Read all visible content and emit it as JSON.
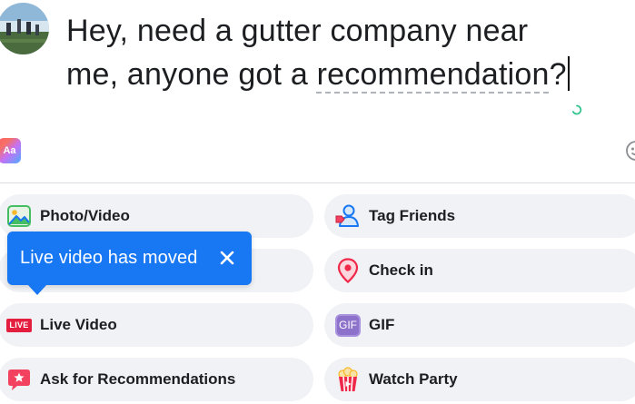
{
  "composer": {
    "text_line1": "Hey, need a gutter company near",
    "text_line2_prefix": "me, anyone got a ",
    "text_misspelled": "recommendation",
    "text_suffix": "?"
  },
  "text_format": {
    "label": "Aa",
    "icon": "text-format-icon"
  },
  "options": {
    "photo_video": {
      "label": "Photo/Video",
      "icon": "photo-icon"
    },
    "tag_friends": {
      "label": "Tag Friends",
      "icon": "tag-friends-icon"
    },
    "check_in": {
      "label": "Check in",
      "icon": "location-pin-icon"
    },
    "live_video": {
      "label": "Live Video",
      "badge": "LIVE",
      "icon": "live-badge-icon"
    },
    "gif": {
      "label": "GIF",
      "badge": "GIF",
      "icon": "gif-icon"
    },
    "ask_recommendations": {
      "label": "Ask for Recommendations",
      "icon": "recommendation-icon"
    },
    "watch_party": {
      "label": "Watch Party",
      "icon": "popcorn-icon"
    }
  },
  "tooltip": {
    "text": "Live video has moved",
    "close_icon": "close-icon"
  },
  "colors": {
    "accent": "#1877f2",
    "option_bg": "#f0f2f5",
    "live_red": "#e41e3f",
    "gif_purple": "#8c72cb",
    "spinner_green": "#31c48d"
  }
}
